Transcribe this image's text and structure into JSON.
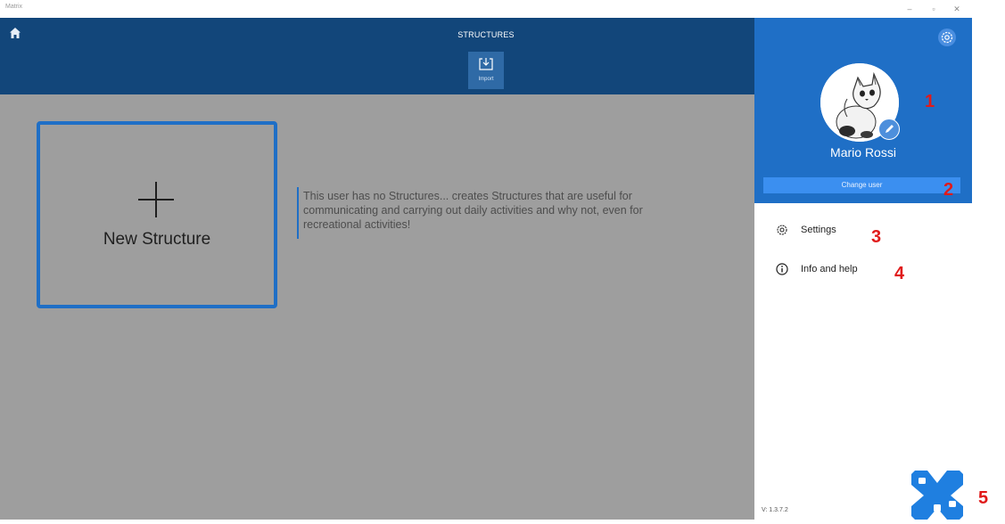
{
  "window": {
    "app_title": "Matrix",
    "minimize_glyph": "–",
    "restore_glyph": "▫",
    "close_glyph": "✕"
  },
  "header": {
    "title": "STRUCTURES",
    "import_label": "Import",
    "home_icon": "home-icon",
    "background": "#12467a"
  },
  "main": {
    "new_structure_label": "New Structure",
    "info_text": "This user has no Structures... creates Structures that are useful for communicating and carrying out daily activities and why not, even for recreational activities!",
    "accent": "#1f6fc6"
  },
  "sidebar": {
    "username": "Mario Rossi",
    "change_user_label": "Change user",
    "items": [
      {
        "label": "Settings",
        "icon": "gear-icon"
      },
      {
        "label": "Info and help",
        "icon": "info-icon"
      }
    ],
    "version": "V: 1.3.7.2",
    "panel_color": "#1f6fc6"
  },
  "annotations": [
    "1",
    "2",
    "3",
    "4",
    "5"
  ]
}
